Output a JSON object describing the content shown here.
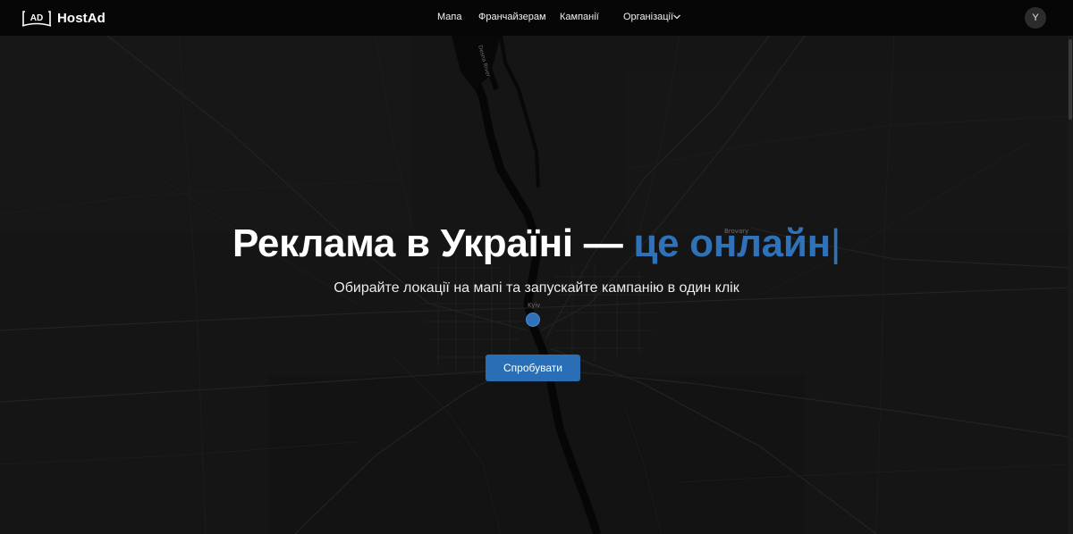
{
  "header": {
    "brand_logo_text": "AD",
    "brand_name": "HostAd",
    "nav": [
      {
        "label": "Мапа"
      },
      {
        "label": "Франчайзерам"
      },
      {
        "label": "Кампанії"
      },
      {
        "label": "Організації"
      }
    ],
    "avatar_initial": "Y"
  },
  "map": {
    "labels": {
      "river": "Desna River",
      "brovary": "Brovary",
      "kyiv": "Kyiv"
    }
  },
  "hero": {
    "title_main": "Реклама в Україні — ",
    "title_accent": "це онлайн",
    "title_cursor": "|",
    "subtitle": "Обирайте локації на мапі та запускайте кампанію в один клік",
    "cta_label": "Спробувати"
  },
  "colors": {
    "accent": "#2f72b9",
    "background": "#141414",
    "navbar": "#060606"
  }
}
